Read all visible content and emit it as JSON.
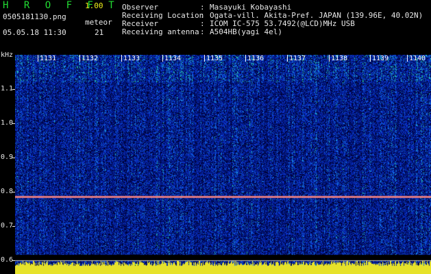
{
  "header": {
    "brand": "H R O F F T",
    "version": "1.00",
    "filename": "0505181130.png",
    "datetime": "05.05.18 11:30",
    "meteor_label": "meteor",
    "meteor_count": "21",
    "fields": [
      {
        "label": "Observer",
        "value": "Masayuki Kobayashi"
      },
      {
        "label": "Receiving Location",
        "value": "Ogata-vill. Akita-Pref. JAPAN (139.96E, 40.02N)"
      },
      {
        "label": "Receiver",
        "value": "ICOM IC-575 53.7492(@LCD)MHz USB"
      },
      {
        "label": "Receiving antenna",
        "value": "A504HB(yagi 4el)"
      }
    ]
  },
  "spectrogram": {
    "y_unit": "kHz",
    "y_ticks": [
      "1.1",
      "1.0",
      "0.9",
      "0.8",
      "0.7",
      "0.6"
    ],
    "y_range_khz": [
      0.6,
      1.15
    ],
    "carrier_khz": 0.77,
    "minute_labels": [
      "1131",
      "1132",
      "1133",
      "1134",
      "1135",
      "1136",
      "1137",
      "1138",
      "1139",
      "1140"
    ],
    "colors": {
      "low": "#000044",
      "mid": "#0a3cc8",
      "high": "#22c8a0",
      "peak": "#e6e640",
      "carrier": "#e07080"
    }
  }
}
